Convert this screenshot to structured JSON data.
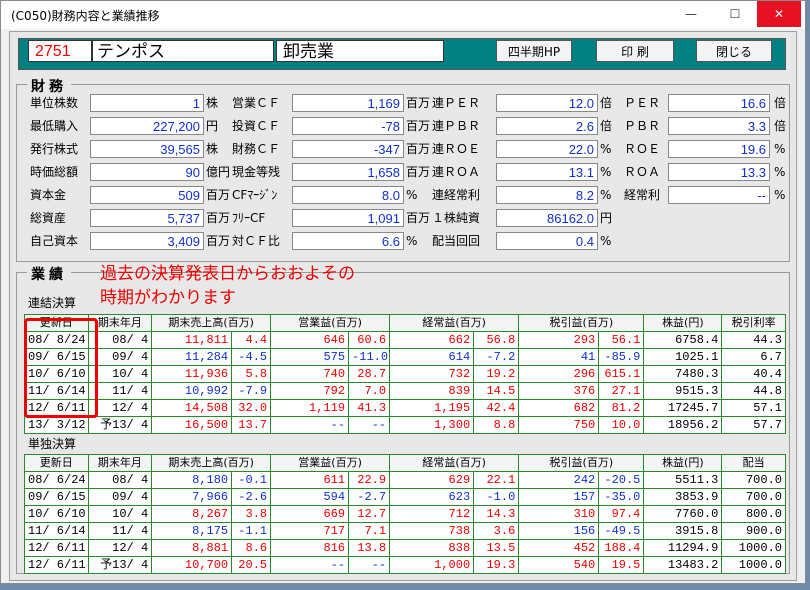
{
  "window": {
    "title": "(C050)財務内容と業績推移",
    "min": "—",
    "max": "☐",
    "close": "✕"
  },
  "header": {
    "code": "2751",
    "name": "テンポス",
    "industry": "卸売業",
    "btn_quarterly": "四半期HP",
    "btn_print": "印 刷",
    "btn_close": "閉じる"
  },
  "finance": {
    "legend": "財務",
    "col1": [
      {
        "label": "単位株数",
        "value": "1",
        "unit": "株"
      },
      {
        "label": "最低購入",
        "value": "227,200",
        "unit": "円"
      },
      {
        "label": "発行株式",
        "value": "39,565",
        "unit": "株"
      },
      {
        "label": "時価総額",
        "value": "90",
        "unit": "億円"
      },
      {
        "label": "資本金",
        "value": "509",
        "unit": "百万"
      },
      {
        "label": "総資産",
        "value": "5,737",
        "unit": "百万"
      },
      {
        "label": "自己資本",
        "value": "3,409",
        "unit": "百万"
      }
    ],
    "col2": [
      {
        "label": "営業ＣＦ",
        "value": "1,169",
        "unit": "百万"
      },
      {
        "label": "投資ＣＦ",
        "value": "-78",
        "unit": "百万"
      },
      {
        "label": "財務ＣＦ",
        "value": "-347",
        "unit": "百万"
      },
      {
        "label": "現金等残",
        "value": "1,658",
        "unit": "百万"
      },
      {
        "label": "CFﾏｰｼﾞﾝ",
        "value": "8.0",
        "unit": "%"
      },
      {
        "label": "ﾌﾘｰCF",
        "value": "1,091",
        "unit": "百万"
      },
      {
        "label": "対ＣＦ比",
        "value": "6.6",
        "unit": "%"
      }
    ],
    "col3": [
      {
        "label": "連ＰＥＲ",
        "value": "12.0",
        "unit": "倍"
      },
      {
        "label": "連ＰＢＲ",
        "value": "2.6",
        "unit": "倍"
      },
      {
        "label": "連ＲＯＥ",
        "value": "22.0",
        "unit": "%"
      },
      {
        "label": "連ＲＯＡ",
        "value": "13.1",
        "unit": "%"
      },
      {
        "label": "連経常利",
        "value": "8.2",
        "unit": "%"
      },
      {
        "label": "１株純資",
        "value": "86162.0",
        "unit": "円"
      },
      {
        "label": "配当回回",
        "value": "0.4",
        "unit": "%"
      }
    ],
    "col4": [
      {
        "label": "ＰＥＲ",
        "value": "16.6",
        "unit": "倍"
      },
      {
        "label": "ＰＢＲ",
        "value": "3.3",
        "unit": "倍"
      },
      {
        "label": "ＲＯＥ",
        "value": "19.6",
        "unit": "%"
      },
      {
        "label": "ＲＯＡ",
        "value": "13.3",
        "unit": "%"
      },
      {
        "label": "経常利",
        "value": "--",
        "unit": "%"
      }
    ]
  },
  "business": {
    "legend": "業績",
    "annotation_line1": "過去の決算発表日からおおよその",
    "annotation_line2": "時期がわかります",
    "consolidated_label": "連結決算",
    "standalone_label": "単独決算",
    "cons_headers": [
      "更新日",
      "期末年月",
      "期末売上高(百万)",
      "",
      "営業益(百万)",
      "",
      "経常益(百万)",
      "",
      "税引益(百万)",
      "",
      "株益(円)",
      "税引利率"
    ],
    "cons_rows": [
      [
        "08/ 8/24",
        "08/ 4",
        "11,811",
        "4.4",
        "646",
        "60.6",
        "662",
        "56.8",
        "293",
        "56.1",
        "6758.4",
        "44.3"
      ],
      [
        "09/ 6/15",
        "09/ 4",
        "11,284",
        "-4.5",
        "575",
        "-11.0",
        "614",
        "-7.2",
        "41",
        "-85.9",
        "1025.1",
        "6.7"
      ],
      [
        "10/ 6/10",
        "10/ 4",
        "11,936",
        "5.8",
        "740",
        "28.7",
        "732",
        "19.2",
        "296",
        "615.1",
        "7480.3",
        "40.4"
      ],
      [
        "11/ 6/14",
        "11/ 4",
        "10,992",
        "-7.9",
        "792",
        "7.0",
        "839",
        "14.5",
        "376",
        "27.1",
        "9515.3",
        "44.8"
      ],
      [
        "12/ 6/11",
        "12/ 4",
        "14,508",
        "32.0",
        "1,119",
        "41.3",
        "1,195",
        "42.4",
        "682",
        "81.2",
        "17245.7",
        "57.1"
      ],
      [
        "13/ 3/12",
        "予13/ 4",
        "16,500",
        "13.7",
        "--",
        "--",
        "1,300",
        "8.8",
        "750",
        "10.0",
        "18956.2",
        "57.7"
      ]
    ],
    "sa_headers": [
      "更新日",
      "期末年月",
      "期末売上高(百万)",
      "",
      "営業益(百万)",
      "",
      "経常益(百万)",
      "",
      "税引益(百万)",
      "",
      "株益(円)",
      "配当"
    ],
    "sa_rows": [
      [
        "08/ 6/24",
        "08/ 4",
        "8,180",
        "-0.1",
        "611",
        "22.9",
        "629",
        "22.1",
        "242",
        "-20.5",
        "5511.3",
        "700.0"
      ],
      [
        "09/ 6/15",
        "09/ 4",
        "7,966",
        "-2.6",
        "594",
        "-2.7",
        "623",
        "-1.0",
        "157",
        "-35.0",
        "3853.9",
        "700.0"
      ],
      [
        "10/ 6/10",
        "10/ 4",
        "8,267",
        "3.8",
        "669",
        "12.7",
        "712",
        "14.3",
        "310",
        "97.4",
        "7760.0",
        "800.0"
      ],
      [
        "11/ 6/14",
        "11/ 4",
        "8,175",
        "-1.1",
        "717",
        "7.1",
        "738",
        "3.6",
        "156",
        "-49.5",
        "3915.8",
        "900.0"
      ],
      [
        "12/ 6/11",
        "12/ 4",
        "8,881",
        "8.6",
        "816",
        "13.8",
        "838",
        "13.5",
        "452",
        "188.4",
        "11294.9",
        "1000.0"
      ],
      [
        "12/ 6/11",
        "予13/ 4",
        "10,700",
        "20.5",
        "--",
        "--",
        "1,000",
        "19.3",
        "540",
        "19.5",
        "13483.2",
        "1000.0"
      ]
    ]
  },
  "colors": {
    "header_bg": "#008080",
    "value_blue": "#1030d0",
    "value_red": "#e00000",
    "grid_green": "#2a8a2a"
  }
}
